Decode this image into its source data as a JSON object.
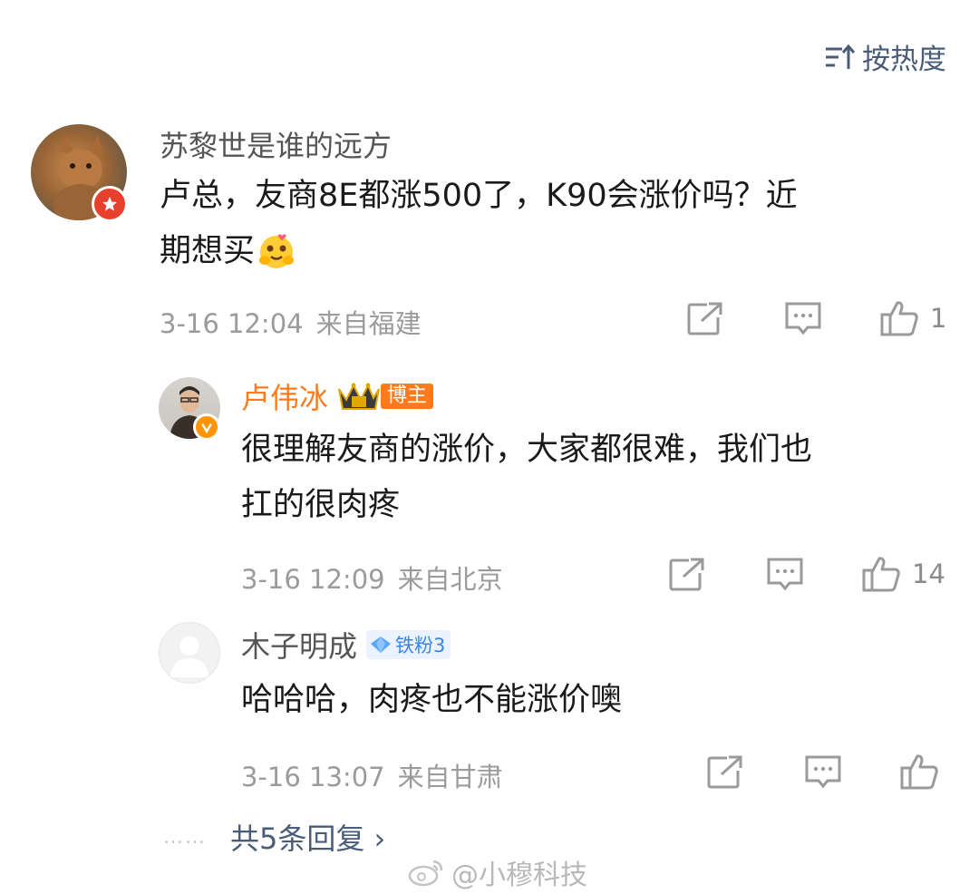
{
  "sort": {
    "label": "按热度",
    "icon": "sort-icon"
  },
  "comments": [
    {
      "username": "苏黎世是谁的远方",
      "text_line1": "卢总，友商8E都涨500了，K90会涨价吗？近",
      "text_line2": "期想买",
      "time": "3-16 12:04",
      "location": "来自福建",
      "like_count": "1"
    }
  ],
  "replies": [
    {
      "username": "卢伟冰",
      "badge": "博主",
      "text_line1": "很理解友商的涨价，大家都很难，我们也",
      "text_line2": "扛的很肉疼",
      "time": "3-16 12:09",
      "location": "来自北京",
      "like_count": "14"
    },
    {
      "username": "木子明成",
      "badge": "铁粉3",
      "text_line1": "哈哈哈，肉疼也不能涨价噢",
      "time": "3-16 13:07",
      "location": "来自甘肃",
      "like_count": ""
    }
  ],
  "more_replies": {
    "label": "共5条回复 ›",
    "dots": "……"
  },
  "watermark": {
    "label": "@小穆科技"
  },
  "colors": {
    "accent_link": "#4a5d78",
    "vip_name": "#ff7a1a",
    "meta": "#9b9b9b"
  }
}
